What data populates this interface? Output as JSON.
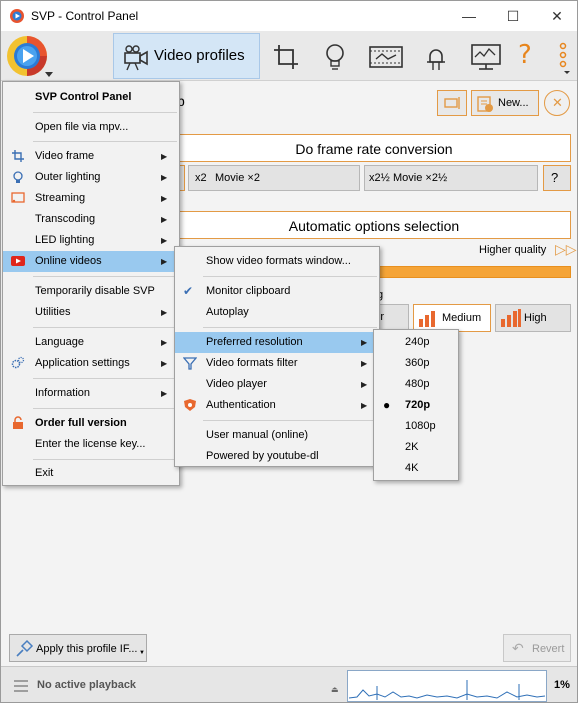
{
  "window": {
    "title": "SVP - Control Panel",
    "minimize": "—",
    "maximize": "☐",
    "close": "✕"
  },
  "toolbar": {
    "active_tab_label": "Video profiles"
  },
  "profile_bar": {
    "profile_name_visible": "p",
    "new_button": "New..."
  },
  "main": {
    "frame_rate_heading": "Do frame rate conversion",
    "movie_x2": "Movie ×2",
    "movie_x2_5": "Movie ×2½",
    "x2_badge": "x2",
    "x2_5_badge": "x2½",
    "auto_heading": "Automatic options selection",
    "higher_quality": "Higher quality",
    "quality_label_fragment": "g",
    "medium": "Medium",
    "high": "High",
    "low_fragment": "r",
    "apply_profile": "Apply this profile IF...",
    "revert": "Revert"
  },
  "status": {
    "no_playback": "No active playback",
    "cpu": "1%"
  },
  "main_menu": {
    "header": "SVP Control Panel",
    "items": [
      {
        "label": "Open file via mpv..."
      },
      {
        "label": "Video frame"
      },
      {
        "label": "Outer lighting"
      },
      {
        "label": "Streaming"
      },
      {
        "label": "Transcoding"
      },
      {
        "label": "LED lighting"
      },
      {
        "label": "Online videos"
      },
      {
        "label": "Temporarily disable SVP"
      },
      {
        "label": "Utilities"
      },
      {
        "label": "Language"
      },
      {
        "label": "Application settings"
      },
      {
        "label": "Information"
      },
      {
        "label": "Order full version"
      },
      {
        "label": "Enter the license key..."
      },
      {
        "label": "Exit"
      }
    ]
  },
  "online_menu": {
    "items": [
      {
        "label": "Show video formats window..."
      },
      {
        "label": "Monitor clipboard"
      },
      {
        "label": "Autoplay"
      },
      {
        "label": "Preferred resolution"
      },
      {
        "label": "Video formats filter"
      },
      {
        "label": "Video player"
      },
      {
        "label": "Authentication"
      },
      {
        "label": "User manual (online)"
      },
      {
        "label": "Powered by youtube-dl"
      }
    ]
  },
  "resolution_menu": {
    "items": [
      {
        "label": "240p"
      },
      {
        "label": "360p"
      },
      {
        "label": "480p"
      },
      {
        "label": "720p"
      },
      {
        "label": "1080p"
      },
      {
        "label": "2K"
      },
      {
        "label": "4K"
      }
    ],
    "selected": "720p"
  },
  "colors": {
    "accent_orange": "#e39a45",
    "menu_highlight": "#99c9ef",
    "toolbar_active": "#d4e6f6"
  }
}
